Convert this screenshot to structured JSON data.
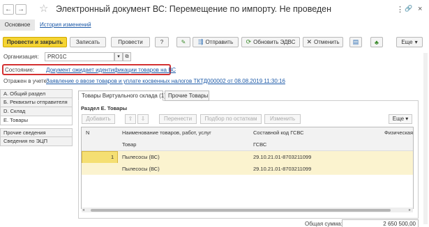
{
  "window": {
    "title": "Электронный документ ВС: Перемещение по импорту. Не проведен",
    "back": "←",
    "forward": "→",
    "star": "☆",
    "more": "⋮",
    "link_icon": "🔗",
    "close": "×"
  },
  "tabs": {
    "main": "Основное",
    "history": "История изменений"
  },
  "toolbar": {
    "post_close": "Провести и закрыть",
    "save": "Записать",
    "post": "Провести",
    "help": "?",
    "edit_icon": "✎",
    "send": "Отправить",
    "update": "Обновить ЭДВС",
    "cancel": "Отменить",
    "more": "Еще"
  },
  "form": {
    "org_label": "Организация:",
    "org_value": "PRO1C",
    "state_label": "Состояние:",
    "state_value": "Документ ожидает идентификации товаров на ВС",
    "reflected_label": "Отражен в учете:",
    "reflected_value": "Заявление о ввозе товаров и уплате косвенных налогов ТКТД000002 от 08.08.2019 11:30:16"
  },
  "sidebar": {
    "items": [
      "А. Общий раздел",
      "Б. Реквизиты отправителя",
      "D. Склад",
      "Е. Товары",
      "Прочие сведения",
      "Сведения по ЭЦП"
    ]
  },
  "subtabs": {
    "virtual": "Товары Виртуального склада (1)",
    "other": "Прочие Товары"
  },
  "section": {
    "title": "Раздел Е. Товары",
    "add": "Добавить",
    "move": "Перенести",
    "pick": "Подбор по остаткам",
    "change": "Изменить",
    "more": "Еще"
  },
  "grid": {
    "headers": {
      "n": "N",
      "name": "Наименование товаров, работ, услуг",
      "name_sub": "Товар",
      "code": "Составной код ГСВС",
      "code_sub": "ГСВС",
      "phys": "Физическая"
    },
    "rows": [
      {
        "n": "1",
        "name": "Пылесосы (ВС)",
        "code": "29.10.21.01-8703211099"
      },
      {
        "n": "",
        "name": "Пылесосы (ВС)",
        "code": "29.10.21.01-8703211099"
      }
    ]
  },
  "footer": {
    "total_label": "Общая сумма:",
    "total_value": "2 650 500,00"
  }
}
